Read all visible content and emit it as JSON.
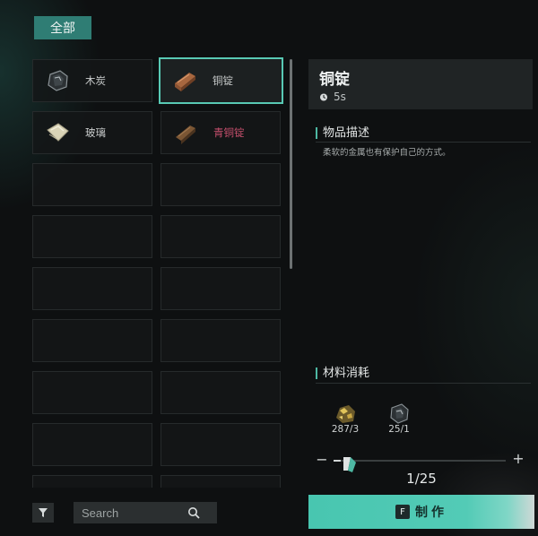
{
  "tabs": {
    "all_label": "全部"
  },
  "items": [
    {
      "name": "木炭",
      "icon": "charcoal-icon",
      "state": "normal"
    },
    {
      "name": "铜锭",
      "icon": "copper-ingot-icon",
      "state": "selected"
    },
    {
      "name": "玻璃",
      "icon": "glass-icon",
      "state": "normal"
    },
    {
      "name": "青铜锭",
      "icon": "bronze-ingot-icon",
      "state": "locked"
    }
  ],
  "search": {
    "placeholder": "Search"
  },
  "detail": {
    "title": "铜锭",
    "craft_time": "5s",
    "description_heading": "物品描述",
    "description": "柔软的金属也有保护自己的方式。",
    "materials_heading": "材料消耗",
    "materials": [
      {
        "icon": "gold-ore-icon",
        "count": "287/3"
      },
      {
        "icon": "charcoal-icon",
        "count": "25/1"
      }
    ]
  },
  "quantity": {
    "minus": "−",
    "plus": "+",
    "value": "1/25",
    "fraction": 0.04
  },
  "craft_button": {
    "key": "F",
    "label": "制作"
  },
  "colors": {
    "accent": "#4db8a3",
    "locked_text": "#c8506e",
    "button": "#48c6b0"
  }
}
